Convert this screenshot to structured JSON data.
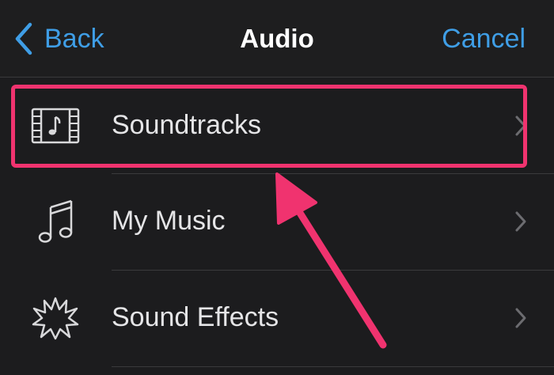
{
  "navbar": {
    "back_label": "Back",
    "title": "Audio",
    "cancel_label": "Cancel"
  },
  "rows": [
    {
      "label": "Soundtracks",
      "icon": "film-music-icon"
    },
    {
      "label": "My Music",
      "icon": "music-note-icon"
    },
    {
      "label": "Sound Effects",
      "icon": "starburst-icon"
    }
  ],
  "colors": {
    "background": "#1c1c1e",
    "accent": "#3f9ee6",
    "highlight": "#f0336f",
    "text": "#e5e5e7",
    "separator": "#3a3a3c"
  }
}
